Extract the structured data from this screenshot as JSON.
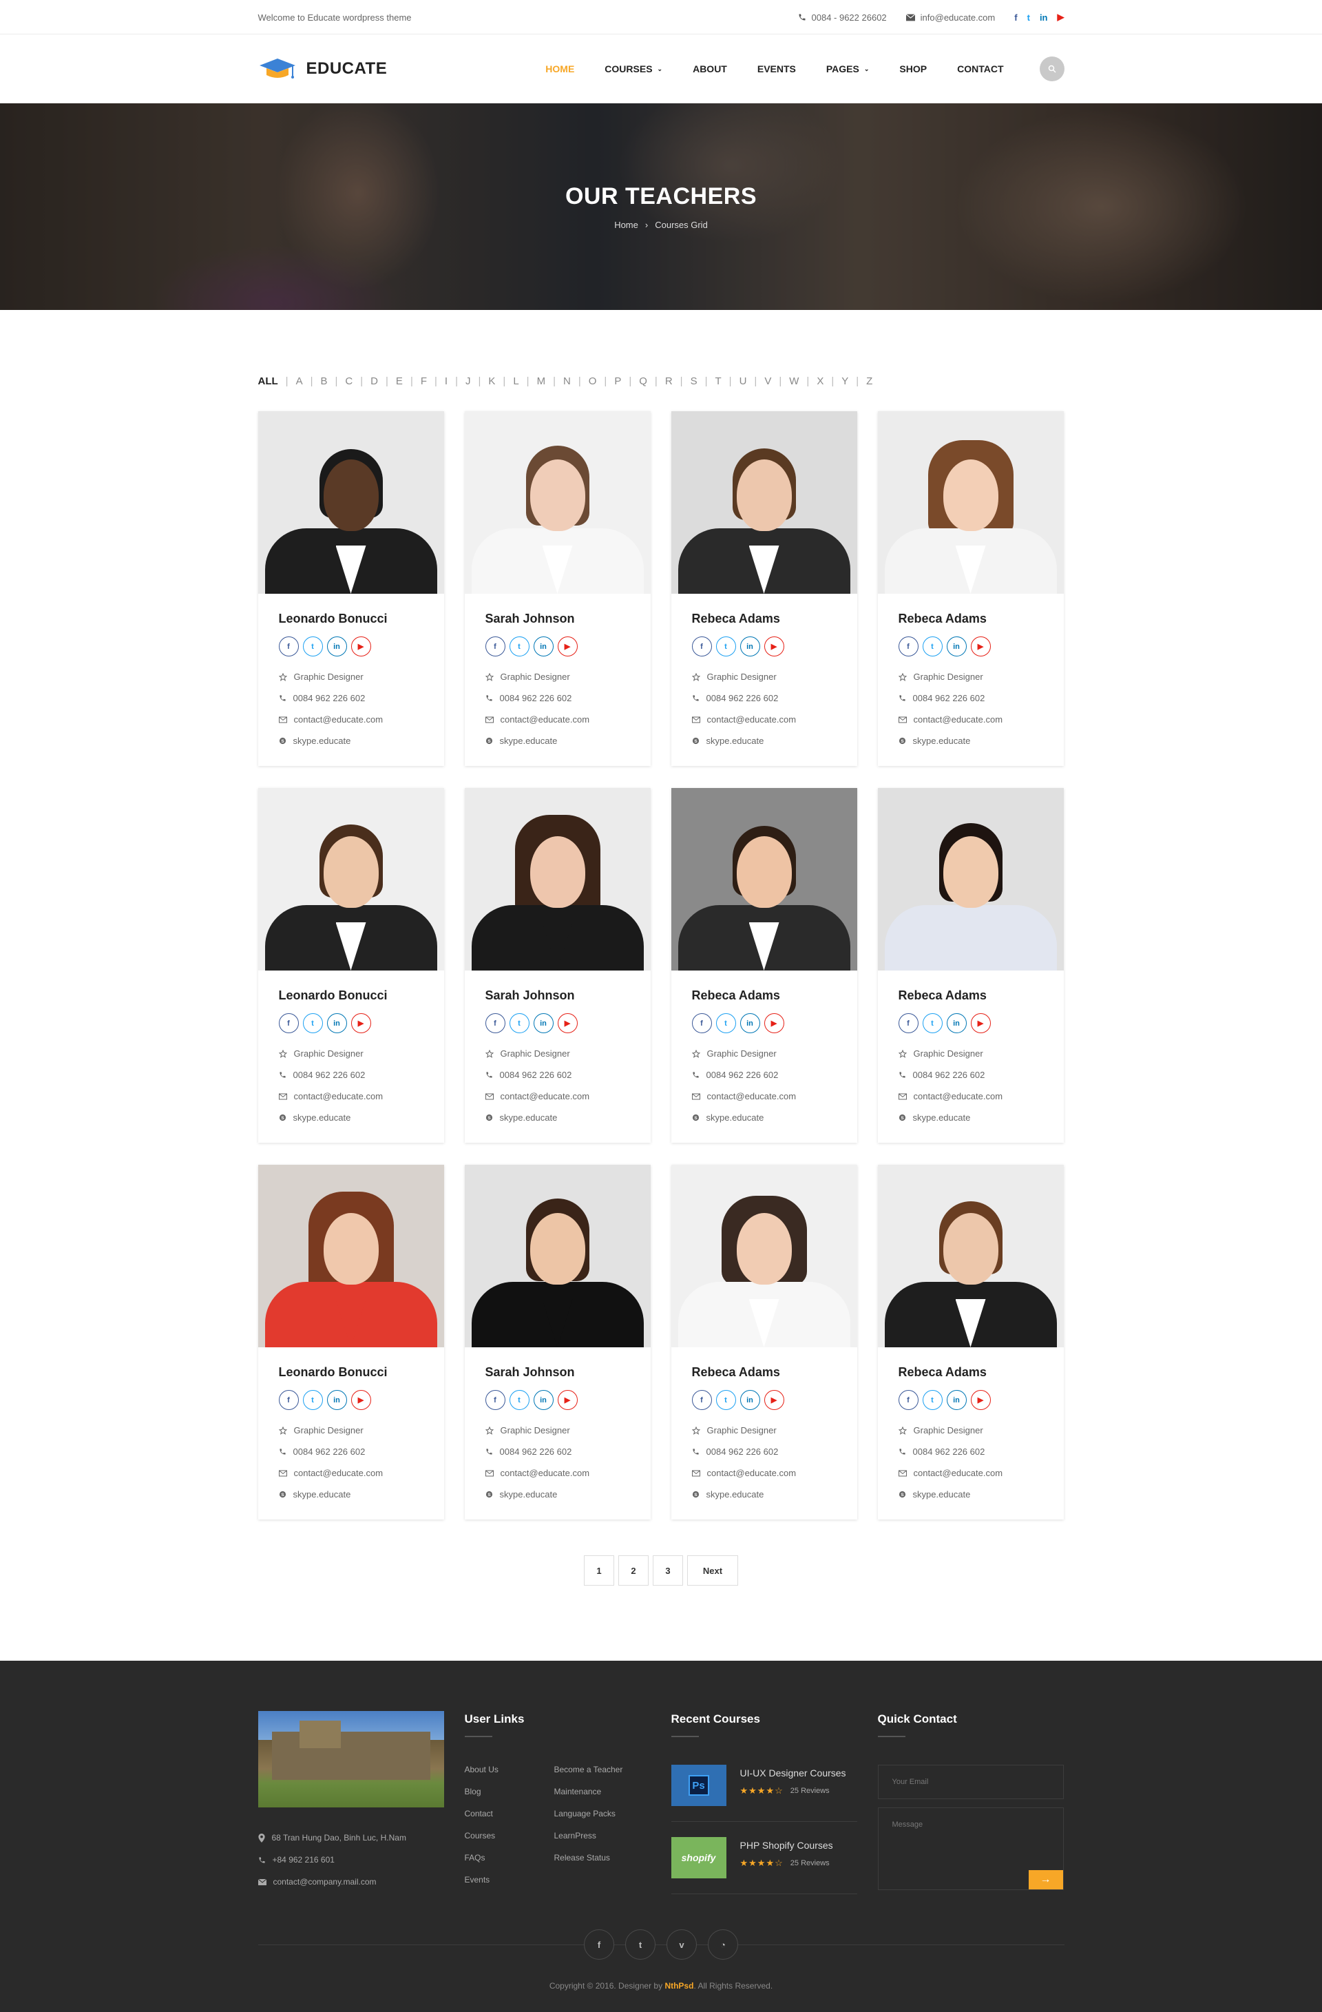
{
  "topbar": {
    "welcome": "Welcome to Educate wordpress theme",
    "phone": "0084 - 9622 26602",
    "email": "info@educate.com",
    "social_icons": [
      "facebook-icon",
      "twitter-icon",
      "linkedin-icon",
      "youtube-icon"
    ]
  },
  "header": {
    "logo": "EDUCATE",
    "nav": [
      {
        "label": "HOME",
        "active": true,
        "dropdown": false
      },
      {
        "label": "COURSES",
        "active": false,
        "dropdown": true
      },
      {
        "label": "ABOUT",
        "active": false,
        "dropdown": false
      },
      {
        "label": "EVENTS",
        "active": false,
        "dropdown": false
      },
      {
        "label": "PAGES",
        "active": false,
        "dropdown": true
      },
      {
        "label": "SHOP",
        "active": false,
        "dropdown": false
      },
      {
        "label": "CONTACT",
        "active": false,
        "dropdown": false
      }
    ]
  },
  "banner": {
    "title": "OUR TEACHERS",
    "breadcrumb": [
      "Home",
      "Courses Grid"
    ]
  },
  "alphabet": [
    "ALL",
    "A",
    "B",
    "C",
    "D",
    "E",
    "F",
    "I",
    "J",
    "K",
    "L",
    "M",
    "N",
    "O",
    "P",
    "Q",
    "R",
    "S",
    "T",
    "U",
    "V",
    "W",
    "X",
    "Y",
    "Z"
  ],
  "teachers": [
    {
      "name": "Leonardo Bonucci",
      "role": "Graphic Designer",
      "phone": "0084 962 226 602",
      "email": "contact@educate.com",
      "skype": "skype.educate"
    },
    {
      "name": "Sarah Johnson",
      "role": "Graphic Designer",
      "phone": "0084 962 226 602",
      "email": "contact@educate.com",
      "skype": "skype.educate"
    },
    {
      "name": "Rebeca Adams",
      "role": "Graphic Designer",
      "phone": "0084 962 226 602",
      "email": "contact@educate.com",
      "skype": "skype.educate"
    },
    {
      "name": "Rebeca Adams",
      "role": "Graphic Designer",
      "phone": "0084 962 226 602",
      "email": "contact@educate.com",
      "skype": "skype.educate"
    },
    {
      "name": "Leonardo Bonucci",
      "role": "Graphic Designer",
      "phone": "0084 962 226 602",
      "email": "contact@educate.com",
      "skype": "skype.educate"
    },
    {
      "name": "Sarah Johnson",
      "role": "Graphic Designer",
      "phone": "0084 962 226 602",
      "email": "contact@educate.com",
      "skype": "skype.educate"
    },
    {
      "name": "Rebeca Adams",
      "role": "Graphic Designer",
      "phone": "0084 962 226 602",
      "email": "contact@educate.com",
      "skype": "skype.educate"
    },
    {
      "name": "Rebeca Adams",
      "role": "Graphic Designer",
      "phone": "0084 962 226 602",
      "email": "contact@educate.com",
      "skype": "skype.educate"
    },
    {
      "name": "Leonardo Bonucci",
      "role": "Graphic Designer",
      "phone": "0084 962 226 602",
      "email": "contact@educate.com",
      "skype": "skype.educate"
    },
    {
      "name": "Sarah Johnson",
      "role": "Graphic Designer",
      "phone": "0084 962 226 602",
      "email": "contact@educate.com",
      "skype": "skype.educate"
    },
    {
      "name": "Rebeca Adams",
      "role": "Graphic Designer",
      "phone": "0084 962 226 602",
      "email": "contact@educate.com",
      "skype": "skype.educate"
    },
    {
      "name": "Rebeca Adams",
      "role": "Graphic Designer",
      "phone": "0084 962 226 602",
      "email": "contact@educate.com",
      "skype": "skype.educate"
    }
  ],
  "pagination": [
    "1",
    "2",
    "3",
    "Next"
  ],
  "footer": {
    "address": "68 Tran Hung Dao, Binh Luc, H.Nam",
    "phone": "+84 962 216 601",
    "email": "contact@company.mail.com",
    "user_links_title": "User Links",
    "links_col1": [
      "About Us",
      "Blog",
      "Contact",
      "Courses",
      "FAQs",
      "Events"
    ],
    "links_col2": [
      "Become a Teacher",
      "Maintenance",
      "Language Packs",
      "LearnPress",
      "Release Status"
    ],
    "recent_title": "Recent Courses",
    "courses": [
      {
        "title": "UI-UX Designer Courses",
        "reviews": "25 Reviews",
        "thumb": "Ps",
        "rating": 3.5
      },
      {
        "title": "PHP Shopify Courses",
        "reviews": "25 Reviews",
        "thumb": "shopify",
        "rating": 3.5
      }
    ],
    "contact_title": "Quick Contact",
    "email_placeholder": "Your Email",
    "message_placeholder": "Message",
    "social_icons": [
      "facebook-icon",
      "twitter-icon",
      "vimeo-icon",
      "rss-icon"
    ],
    "copyright_pre": "Copyright © 2016. Designer by ",
    "copyright_brand": "NthPsd",
    "copyright_post": ". All Rights Reserved."
  },
  "colors": {
    "accent": "#f7a727",
    "footer_bg": "#2a2a2a"
  }
}
